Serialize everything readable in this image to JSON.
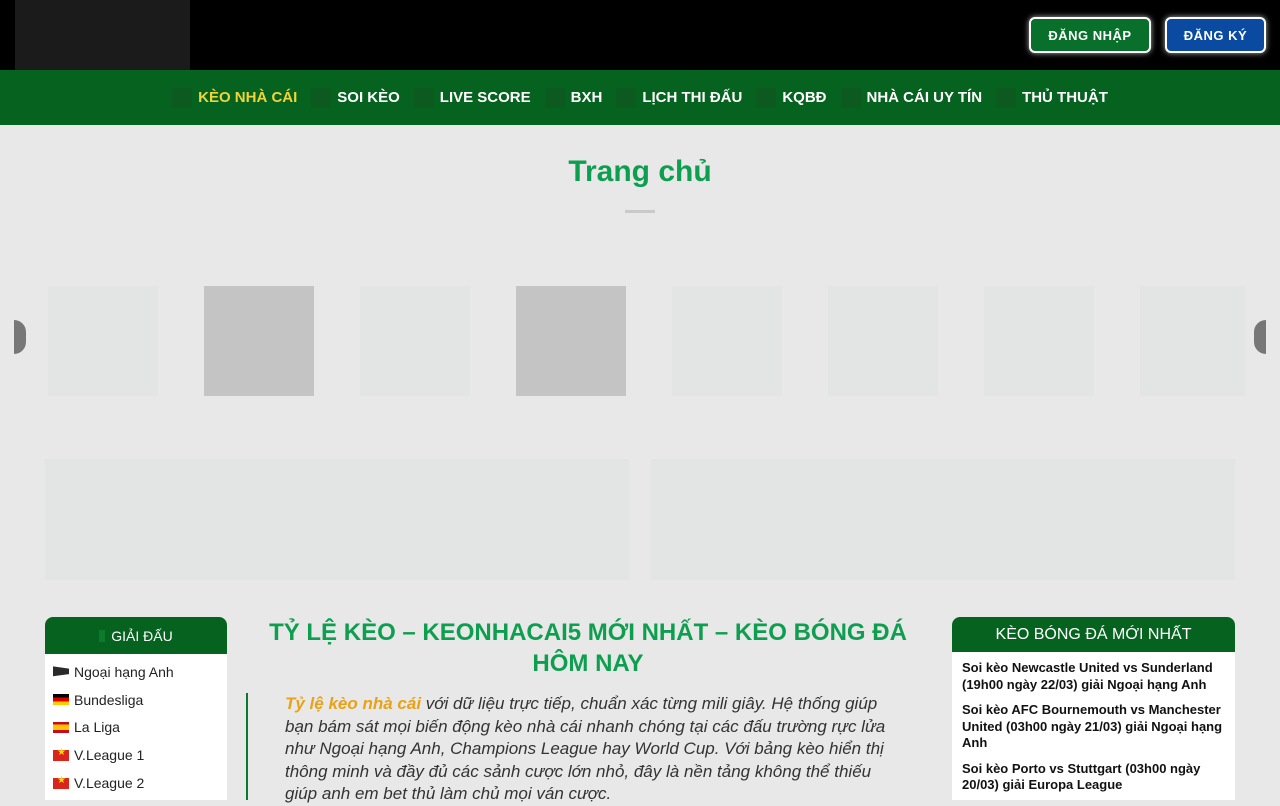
{
  "header": {
    "login_label": "ĐĂNG NHẬP",
    "register_label": "ĐĂNG KÝ"
  },
  "nav": [
    {
      "label": "KÈO NHÀ CÁI",
      "active": true
    },
    {
      "label": "SOI KÈO"
    },
    {
      "label": "LIVE SCORE"
    },
    {
      "label": "BXH"
    },
    {
      "label": "LỊCH THI ĐẤU"
    },
    {
      "label": "KQBĐ"
    },
    {
      "label": "NHÀ CÁI UY TÍN"
    },
    {
      "label": "THỦ THUẬT"
    }
  ],
  "page_title": "Trang chủ",
  "sidebar": {
    "title": "GIẢI ĐẤU",
    "items": [
      {
        "label": "Ngoại hạng Anh",
        "flag": "england-flag-icon"
      },
      {
        "label": "Bundesliga",
        "flag": "germany-flag-icon"
      },
      {
        "label": "La Liga",
        "flag": "spain-flag-icon"
      },
      {
        "label": "V.League 1",
        "flag": "vietnam-flag-icon"
      },
      {
        "label": "V.League 2",
        "flag": "vietnam-flag-icon"
      }
    ]
  },
  "main": {
    "title": "TỶ LỆ KÈO – KEONHACAI5 MỚI NHẤT – KÈO BÓNG ĐÁ HÔM NAY",
    "intro_highlight": "Tỷ lệ kèo nhà cái",
    "intro_text": " với dữ liệu trực tiếp, chuẩn xác từng mili giây. Hệ thống giúp bạn bám sát mọi biến động kèo nhà cái nhanh chóng tại các đấu trường rực lửa như Ngoại hạng Anh, Champions League hay World Cup. Với bảng kèo hiển thị thông minh và đầy đủ các sảnh cược lớn nhỏ, đây là nền tảng không thể thiếu giúp anh em bet thủ làm chủ mọi ván cược."
  },
  "right_sidebar": {
    "title": "KÈO BÓNG ĐÁ MỚI NHẤT",
    "items": [
      "Soi kèo Newcastle United vs Sunderland (19h00 ngày 22/03) giải Ngoại hạng Anh",
      "Soi kèo AFC Bournemouth vs Manchester United (03h00 ngày 21/03) giải Ngoại hạng Anh",
      "Soi kèo Porto vs Stuttgart (03h00 ngày 20/03) giải Europa League"
    ]
  },
  "colors": {
    "header_bg": "#000000",
    "nav_bg": "#06631f",
    "accent_green": "#0d9f4f",
    "nav_active": "#f0d43a",
    "highlight": "#e8a218",
    "register_blue": "#0b4aa1"
  }
}
